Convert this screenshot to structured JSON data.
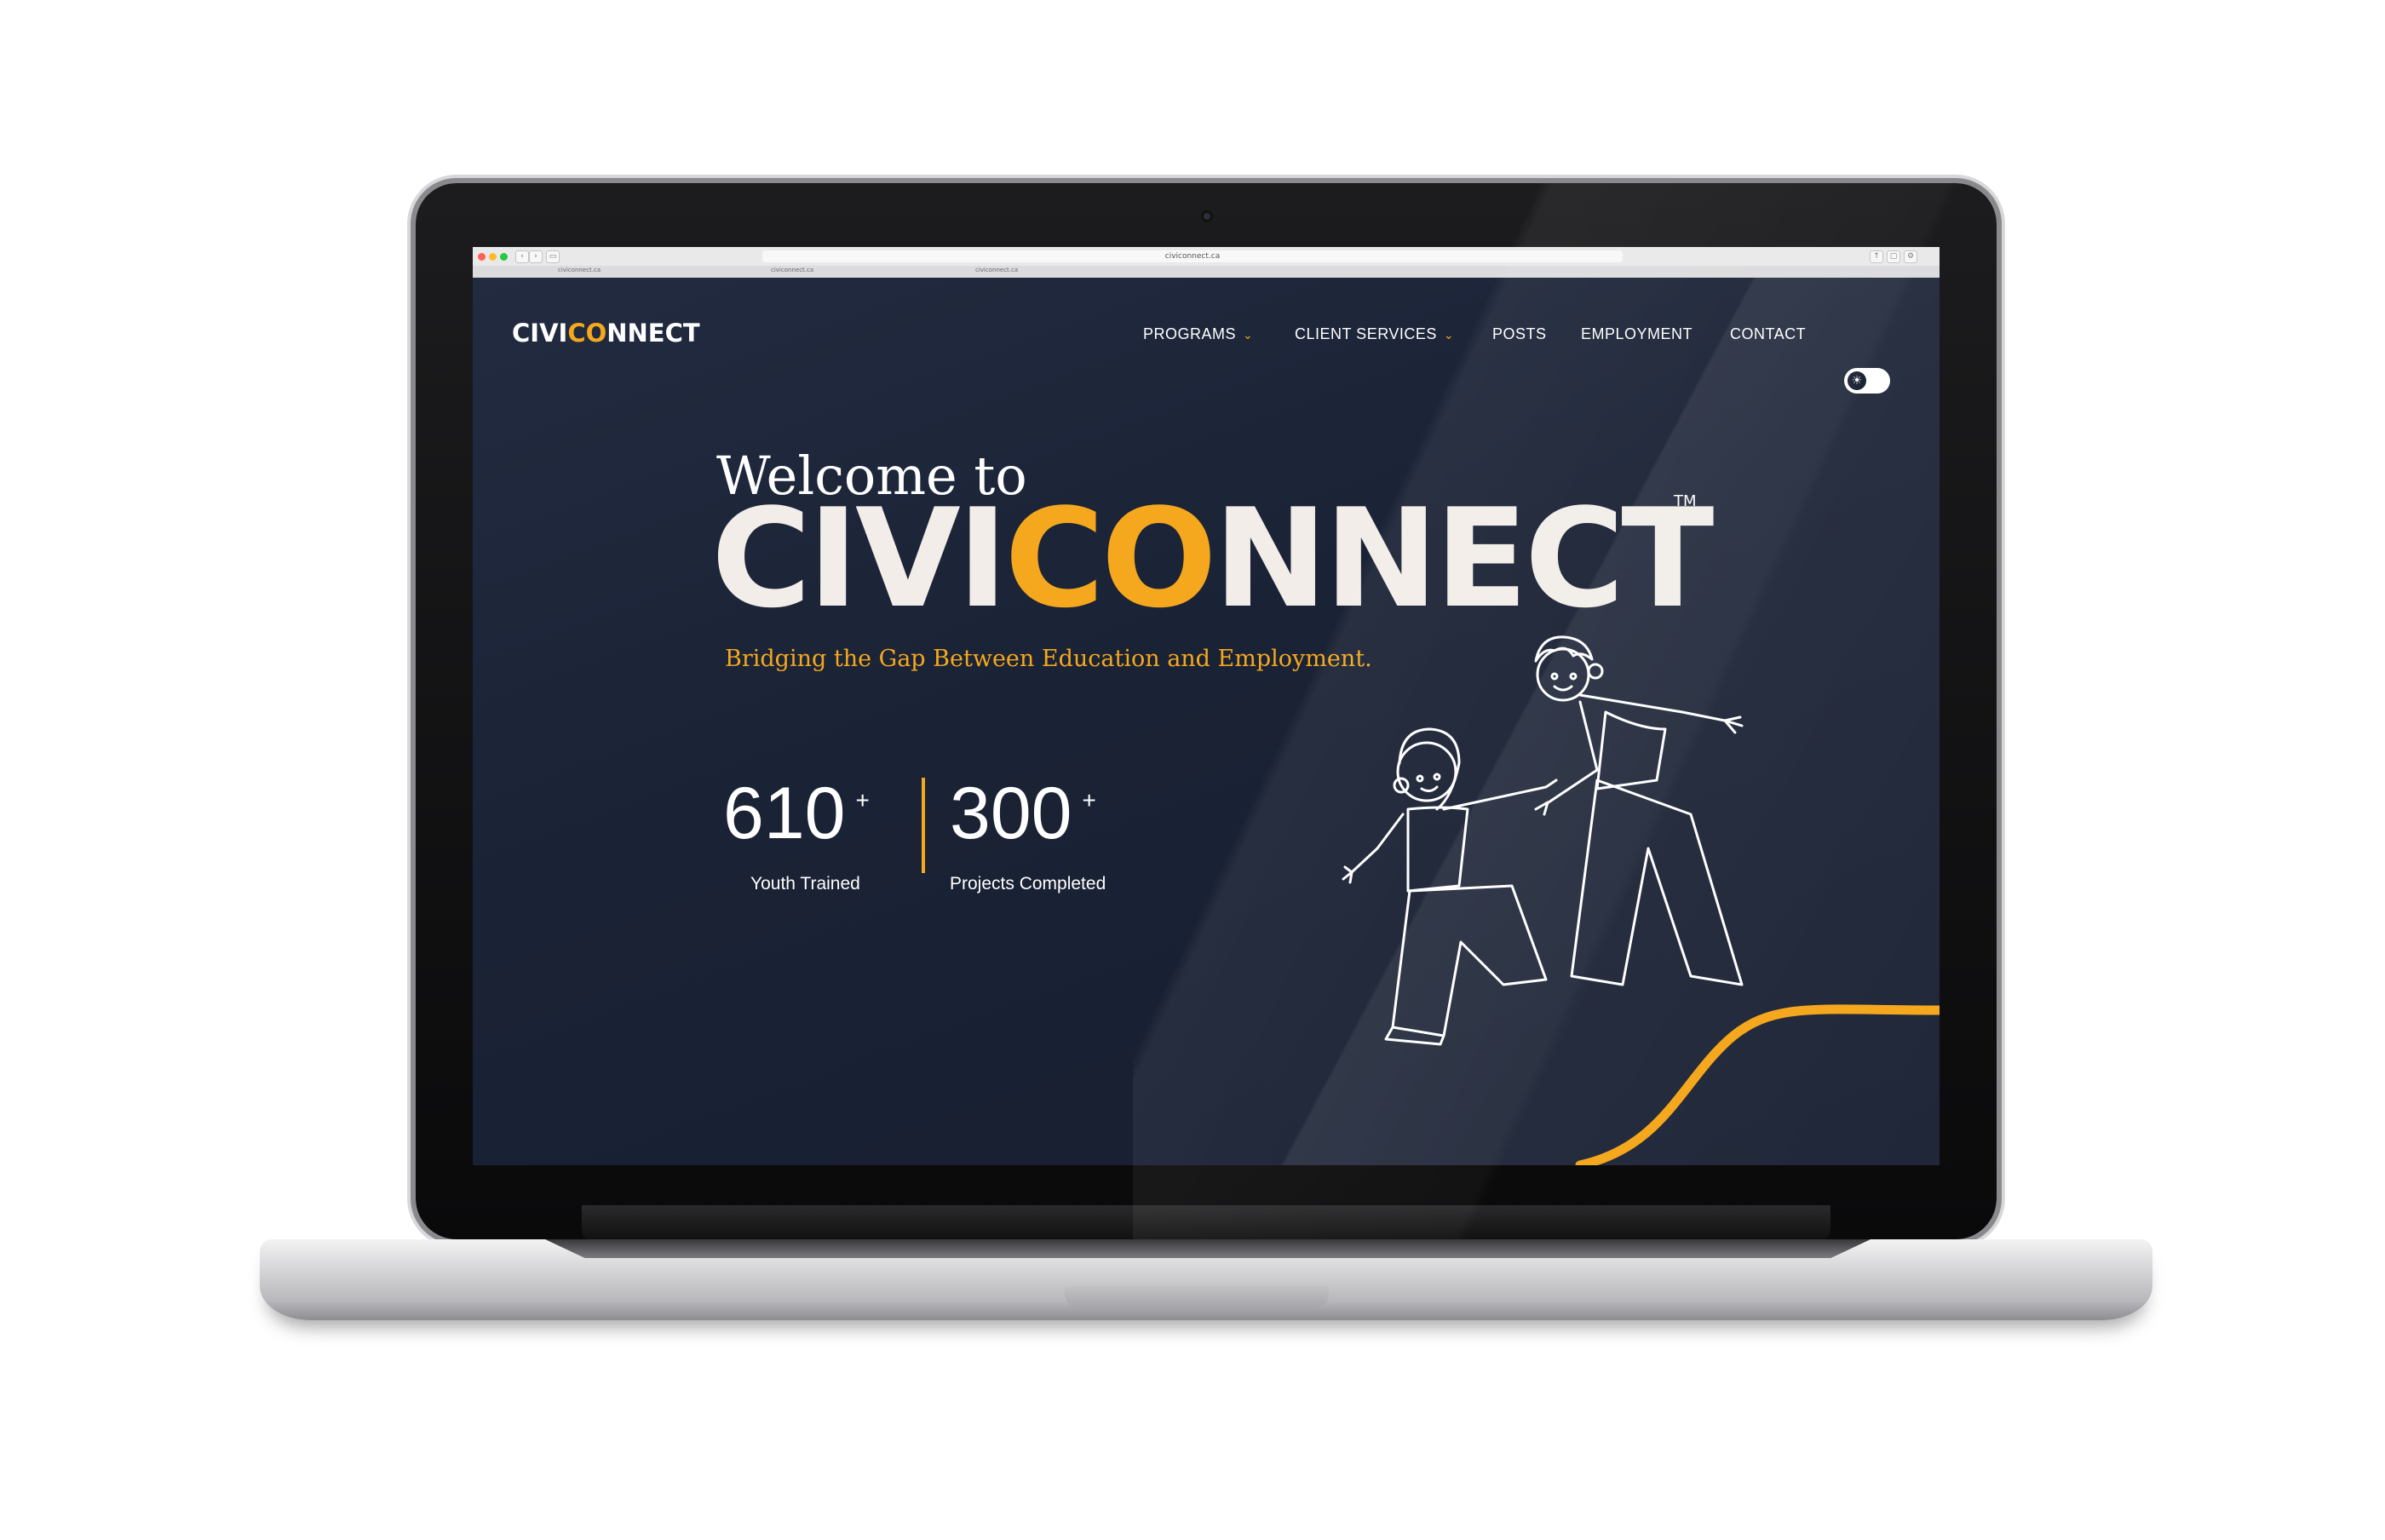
{
  "browser": {
    "address": "civiconnect.ca",
    "tabs": [
      "civiconnect.ca",
      "civiconnect.ca",
      "civiconnect.ca"
    ]
  },
  "site": {
    "logo": {
      "main": "CIVI",
      "accent": "CO",
      "rest": "NNECT"
    },
    "nav": {
      "programs": "PROGRAMS",
      "client_services": "CLIENT SERVICES",
      "posts": "POSTS",
      "employment": "EMPLOYMENT",
      "contact": "CONTACT"
    },
    "hero": {
      "welcome": "Welcome to",
      "brand_main": "CIVI",
      "brand_accent": "CO",
      "brand_rest": "NNECT",
      "trademark": "TM",
      "tagline": "Bridging the Gap Between Education and Employment."
    },
    "stats": [
      {
        "value": "610",
        "suffix": "+",
        "label": "Youth Trained"
      },
      {
        "value": "300",
        "suffix": "+",
        "label": "Projects Completed"
      }
    ]
  },
  "colors": {
    "background": "#1a2235",
    "accent": "#f5a81d",
    "text": "#ffffff"
  },
  "icons": {
    "dropdown": "chevron-down-icon",
    "theme_toggle": "sun-icon"
  }
}
